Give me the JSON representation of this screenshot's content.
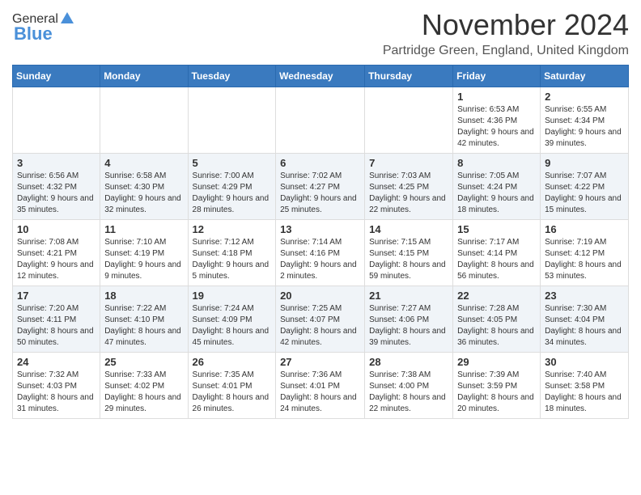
{
  "header": {
    "logo_general": "General",
    "logo_blue": "Blue",
    "month_title": "November 2024",
    "subtitle": "Partridge Green, England, United Kingdom"
  },
  "weekdays": [
    "Sunday",
    "Monday",
    "Tuesday",
    "Wednesday",
    "Thursday",
    "Friday",
    "Saturday"
  ],
  "weeks": [
    [
      {
        "day": "",
        "info": ""
      },
      {
        "day": "",
        "info": ""
      },
      {
        "day": "",
        "info": ""
      },
      {
        "day": "",
        "info": ""
      },
      {
        "day": "",
        "info": ""
      },
      {
        "day": "1",
        "info": "Sunrise: 6:53 AM\nSunset: 4:36 PM\nDaylight: 9 hours and 42 minutes."
      },
      {
        "day": "2",
        "info": "Sunrise: 6:55 AM\nSunset: 4:34 PM\nDaylight: 9 hours and 39 minutes."
      }
    ],
    [
      {
        "day": "3",
        "info": "Sunrise: 6:56 AM\nSunset: 4:32 PM\nDaylight: 9 hours and 35 minutes."
      },
      {
        "day": "4",
        "info": "Sunrise: 6:58 AM\nSunset: 4:30 PM\nDaylight: 9 hours and 32 minutes."
      },
      {
        "day": "5",
        "info": "Sunrise: 7:00 AM\nSunset: 4:29 PM\nDaylight: 9 hours and 28 minutes."
      },
      {
        "day": "6",
        "info": "Sunrise: 7:02 AM\nSunset: 4:27 PM\nDaylight: 9 hours and 25 minutes."
      },
      {
        "day": "7",
        "info": "Sunrise: 7:03 AM\nSunset: 4:25 PM\nDaylight: 9 hours and 22 minutes."
      },
      {
        "day": "8",
        "info": "Sunrise: 7:05 AM\nSunset: 4:24 PM\nDaylight: 9 hours and 18 minutes."
      },
      {
        "day": "9",
        "info": "Sunrise: 7:07 AM\nSunset: 4:22 PM\nDaylight: 9 hours and 15 minutes."
      }
    ],
    [
      {
        "day": "10",
        "info": "Sunrise: 7:08 AM\nSunset: 4:21 PM\nDaylight: 9 hours and 12 minutes."
      },
      {
        "day": "11",
        "info": "Sunrise: 7:10 AM\nSunset: 4:19 PM\nDaylight: 9 hours and 9 minutes."
      },
      {
        "day": "12",
        "info": "Sunrise: 7:12 AM\nSunset: 4:18 PM\nDaylight: 9 hours and 5 minutes."
      },
      {
        "day": "13",
        "info": "Sunrise: 7:14 AM\nSunset: 4:16 PM\nDaylight: 9 hours and 2 minutes."
      },
      {
        "day": "14",
        "info": "Sunrise: 7:15 AM\nSunset: 4:15 PM\nDaylight: 8 hours and 59 minutes."
      },
      {
        "day": "15",
        "info": "Sunrise: 7:17 AM\nSunset: 4:14 PM\nDaylight: 8 hours and 56 minutes."
      },
      {
        "day": "16",
        "info": "Sunrise: 7:19 AM\nSunset: 4:12 PM\nDaylight: 8 hours and 53 minutes."
      }
    ],
    [
      {
        "day": "17",
        "info": "Sunrise: 7:20 AM\nSunset: 4:11 PM\nDaylight: 8 hours and 50 minutes."
      },
      {
        "day": "18",
        "info": "Sunrise: 7:22 AM\nSunset: 4:10 PM\nDaylight: 8 hours and 47 minutes."
      },
      {
        "day": "19",
        "info": "Sunrise: 7:24 AM\nSunset: 4:09 PM\nDaylight: 8 hours and 45 minutes."
      },
      {
        "day": "20",
        "info": "Sunrise: 7:25 AM\nSunset: 4:07 PM\nDaylight: 8 hours and 42 minutes."
      },
      {
        "day": "21",
        "info": "Sunrise: 7:27 AM\nSunset: 4:06 PM\nDaylight: 8 hours and 39 minutes."
      },
      {
        "day": "22",
        "info": "Sunrise: 7:28 AM\nSunset: 4:05 PM\nDaylight: 8 hours and 36 minutes."
      },
      {
        "day": "23",
        "info": "Sunrise: 7:30 AM\nSunset: 4:04 PM\nDaylight: 8 hours and 34 minutes."
      }
    ],
    [
      {
        "day": "24",
        "info": "Sunrise: 7:32 AM\nSunset: 4:03 PM\nDaylight: 8 hours and 31 minutes."
      },
      {
        "day": "25",
        "info": "Sunrise: 7:33 AM\nSunset: 4:02 PM\nDaylight: 8 hours and 29 minutes."
      },
      {
        "day": "26",
        "info": "Sunrise: 7:35 AM\nSunset: 4:01 PM\nDaylight: 8 hours and 26 minutes."
      },
      {
        "day": "27",
        "info": "Sunrise: 7:36 AM\nSunset: 4:01 PM\nDaylight: 8 hours and 24 minutes."
      },
      {
        "day": "28",
        "info": "Sunrise: 7:38 AM\nSunset: 4:00 PM\nDaylight: 8 hours and 22 minutes."
      },
      {
        "day": "29",
        "info": "Sunrise: 7:39 AM\nSunset: 3:59 PM\nDaylight: 8 hours and 20 minutes."
      },
      {
        "day": "30",
        "info": "Sunrise: 7:40 AM\nSunset: 3:58 PM\nDaylight: 8 hours and 18 minutes."
      }
    ]
  ]
}
